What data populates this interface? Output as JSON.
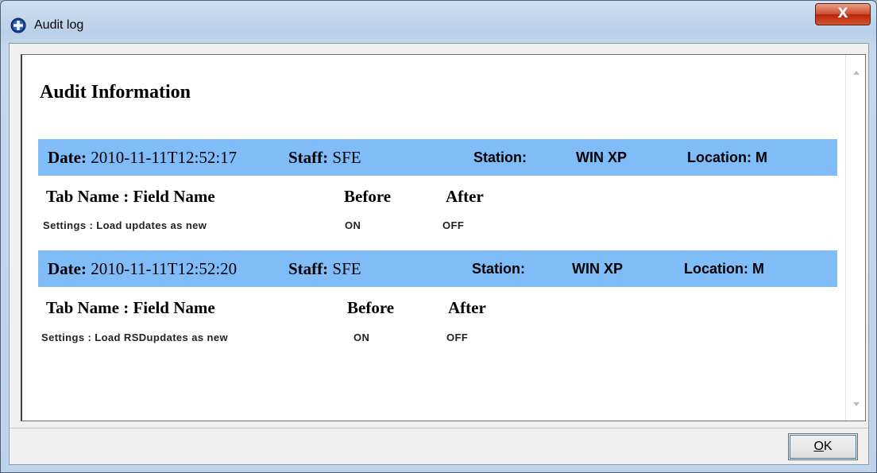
{
  "window": {
    "title": "Audit log",
    "close_label": "X"
  },
  "heading": "Audit Information",
  "records": [
    {
      "date_label": "Date:",
      "date": "2010-11-11T12:52:17",
      "staff_label": "Staff:",
      "staff": "SFE",
      "station_label": "Station:",
      "station": "WIN XP",
      "location_label": "Location:",
      "location": "M",
      "col_field": "Tab Name : Field Name",
      "col_before": "Before",
      "col_after": "After",
      "rows": [
        {
          "field": "Settings : Load updates as new",
          "before": "ON",
          "after": "OFF"
        }
      ]
    },
    {
      "date_label": "Date:",
      "date": "2010-11-11T12:52:20",
      "staff_label": "Staff:",
      "staff": "SFE",
      "station_label": "Station:",
      "station": "WIN XP",
      "location_label": "Location:",
      "location": "M",
      "col_field": "Tab Name : Field Name",
      "col_before": "Before",
      "col_after": "After",
      "rows": [
        {
          "field": "Settings : Load RSDupdates as new",
          "before": "ON",
          "after": "OFF"
        }
      ]
    }
  ],
  "footer": {
    "ok_accel": "O",
    "ok_rest": "K"
  }
}
